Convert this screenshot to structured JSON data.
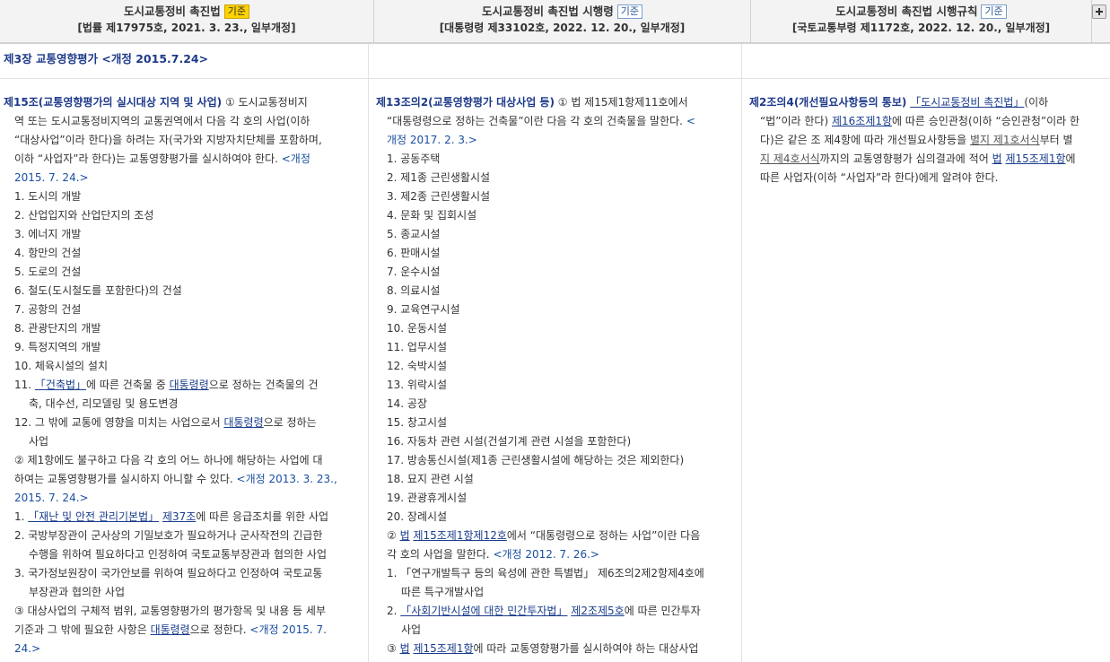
{
  "header": {
    "col1": {
      "title": "도시교통정비 촉진법",
      "badge": "기준",
      "sub": "[법률 제17975호, 2021. 3. 23., 일부개정]"
    },
    "col2": {
      "title": "도시교통정비 촉진법 시행령",
      "badge": "기준",
      "sub": "[대통령령 제33102호, 2022. 12. 20., 일부개정]"
    },
    "col3": {
      "title": "도시교통정비 촉진법 시행규칙",
      "badge": "기준",
      "sub": "[국토교통부령 제1172호, 2022. 12. 20., 일부개정]"
    }
  },
  "chapter": {
    "title": "제3장 교통영향평가 <개정 2015.7.24>"
  },
  "col1": {
    "a_title": "제15조(교통영향평가의 실시대상 지역 및 사업)",
    "a_l1": "① 도시교통정비지",
    "a_l2": "역 또는 도시교통정비지역의 교통권역에서 다음 각 호의 사업(이하",
    "a_l3": "“대상사업”이라 한다)을 하려는 자(국가와 지방자치단체를 포함하며,",
    "a_l4": "이하 “사업자”라 한다)는 교통영향평가를 실시하여야 한다.",
    "a_l4b": " <개정",
    "a_l5": "2015. 7. 24.>",
    "items": [
      "1. 도시의 개발",
      "2. 산업입지와 산업단지의 조성",
      "3. 에너지 개발",
      "4. 항만의 건설",
      "5. 도로의 건설",
      "6. 철도(도시철도를 포함한다)의 건설",
      "7. 공항의 건설",
      "8. 관광단지의 개발",
      "9. 특정지역의 개발",
      "10. 체육시설의 설치"
    ],
    "i11_pre": "11. ",
    "i11_law": "「건축법」",
    "i11_mid": "에 따른 건축물 중 ",
    "i11_link": "대통령령",
    "i11_post": "으로 정하는 건축물의 건",
    "i11_l2": "축, 대수선, 리모델링 및 용도변경",
    "i12_pre": "12. 그 밖에 교통에 영향을 미치는 사업으로서 ",
    "i12_link": "대통령령",
    "i12_post": "으로 정하는",
    "i12_l2": "사업",
    "p2_l1": "② 제1항에도 불구하고 다음 각 호의 어느 하나에 해당하는 사업에 대",
    "p2_l2": "하여는 교통영향평가를 실시하지 아니할 수 있다.",
    "p2_l2b": " <개정 2013. 3. 23.,",
    "p2_l3": "2015. 7. 24.>",
    "p2i1_pre": "1. ",
    "p2i1_law": "「재난 및 안전 관리기본법」",
    "p2i1_sp": " ",
    "p2i1_art": "제37조",
    "p2i1_post": "에 따른 응급조치를 위한 사업",
    "p2i2_l1": "2. 국방부장관이 군사상의 기밀보호가 필요하거나 군사작전의 긴급한",
    "p2i2_l2": "수행을 위하여 필요하다고 인정하여 국토교통부장관과 협의한 사업",
    "p2i3_l1": "3. 국가정보원장이 국가안보를 위하여 필요하다고 인정하여 국토교통",
    "p2i3_l2": "부장관과 협의한 사업",
    "p3_l1": "③ 대상사업의 구체적 범위, 교통영향평가의 평가항목 및 내용 등 세부",
    "p3_l2_pre": "기준과 그 밖에 필요한 사항은 ",
    "p3_l2_link": "대통령령",
    "p3_l2_post": "으로 정한다.",
    "p3_l2b": " <개정 2015. 7.",
    "p3_l3": "24.>"
  },
  "col2": {
    "a_title": "제13조의2(교통영향평가 대상사업 등)",
    "a_l1": " ① 법 제15제1항제11호에서",
    "a_l2": "“대통령령으로 정하는 건축물”이란 다음 각 호의 건축물을 말한다.",
    "a_l2b": " <",
    "a_l3": "개정 2017. 2. 3.>",
    "items": [
      "1. 공동주택",
      "2. 제1종 근린생활시설",
      "3. 제2종 근린생활시설",
      "4. 문화 및 집회시설",
      "5. 종교시설",
      "6. 판매시설",
      "7. 운수시설",
      "8. 의료시설",
      "9. 교육연구시설",
      "10. 운동시설",
      "11. 업무시설",
      "12. 숙박시설",
      "13. 위락시설",
      "14. 공장",
      "15. 창고시설",
      "16. 자동차 관련 시설(건설기계 관련 시설을 포함한다)",
      "17. 방송통신시설(제1종 근린생활시설에 해당하는 것은 제외한다)",
      "18. 묘지 관련 시설",
      "19. 관광휴게시설",
      "20. 장례시설"
    ],
    "p2_circ": "② ",
    "p2_law": "법",
    "p2_art1": "제15조제1항",
    "p2_art2": "제12호",
    "p2_post": "에서 “대통령령으로 정하는 사업”이란 다음",
    "p2_l2": "각 호의 사업을 말한다.",
    "p2_l2b": " <개정 2012. 7. 26.>",
    "p2i1_l1": "1. 「연구개발특구 등의 육성에 관한 특별법」 제6조의2제2항제4호에",
    "p2i1_l2": "따른 특구개발사업",
    "p2i2_pre": "2. ",
    "p2i2_law": "「사회기반시설에 대한 민간투자법」",
    "p2i2_sp": " ",
    "p2i2_art": "제2조제5호",
    "p2i2_post": "에 따른 민간투자",
    "p2i2_l2": "사업",
    "p3_circ": "③ ",
    "p3_law": "법",
    "p3_art": "제15조제1항",
    "p3_post": "에 따라 교통영향평가를 실시하여야 하는 대상사업"
  },
  "col3": {
    "a_title": "제2조의4(개선필요사항등의 통보)",
    "a_l1_law": "「도시교통정비 촉진법」",
    "a_l1_post": "(이하",
    "a_l2_pre": "“법”이라 한다) ",
    "a_l2_art1": "제16조",
    "a_l2_art2": "제1항",
    "a_l2_post": "에 따른 승인관청(이하 “승인관청”이라 한",
    "a_l3_pre": "다)은 같은 조 제4항에 따라 개선필요사항등을 ",
    "a_l3_link": "별지 제1호서식",
    "a_l3_post": "부터 별",
    "a_l4_link": "지 제4호서식",
    "a_l4_mid": "까지의 교통영향평가 심의결과에 적어 ",
    "a_l4_law": "법",
    "a_l4_art1": "제15조",
    "a_l4_art2": "제1항",
    "a_l4_post": "에",
    "a_l5": "따른 사업자(이하 “사업자”라 한다)에게 알려야 한다."
  }
}
